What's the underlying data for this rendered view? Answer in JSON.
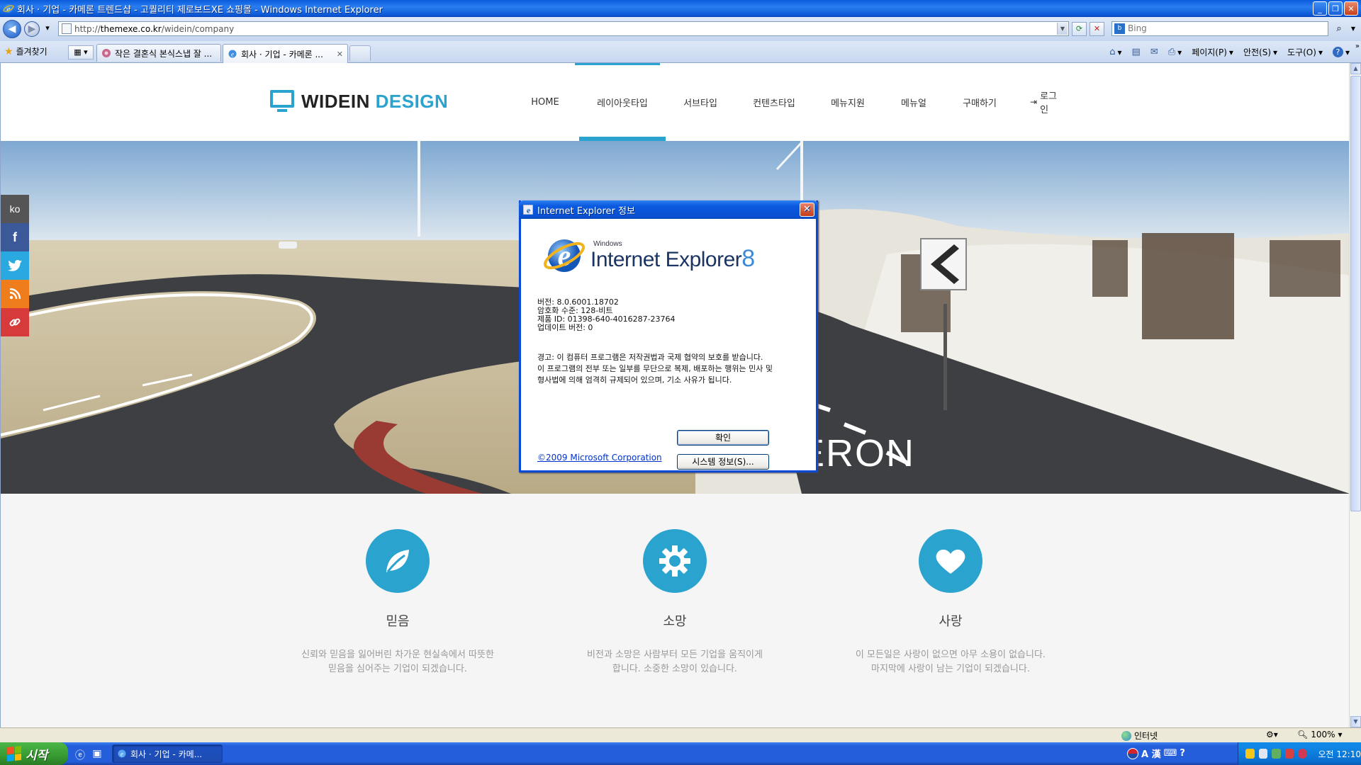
{
  "window": {
    "title": "회사 · 기업 - 카메론 트렌드샵 - 고퀄리티 제로보드XE 쇼핑몰 - Windows Internet Explorer",
    "minimize": "_",
    "maximize": "❐",
    "close": "✕"
  },
  "address": {
    "prefix": "http://",
    "domain": "themexe.co.kr",
    "path": "/widein/company",
    "search_placeholder": "Bing",
    "bing_logo": "b"
  },
  "favorites": {
    "label": "즐겨찾기"
  },
  "tabs": [
    {
      "label": "작은 결혼식 본식스냅 잘 ..."
    },
    {
      "label": "회사 · 기업 - 카메론 ...",
      "close": "✕"
    }
  ],
  "commandbar": {
    "page": "페이지(P)",
    "safety": "안전(S)",
    "tools": "도구(O)",
    "help": "?"
  },
  "site": {
    "logo_word1": "WIDEIN",
    "logo_word2": "DESIGN",
    "menu": [
      {
        "label": "HOME"
      },
      {
        "label": "레이아웃타입"
      },
      {
        "label": "서브타입"
      },
      {
        "label": "컨텐츠타입"
      },
      {
        "label": "메뉴지원"
      },
      {
        "label": "메뉴얼"
      },
      {
        "label": "구매하기"
      },
      {
        "label": "로그인"
      }
    ],
    "hero_text": "CAMERON",
    "social": {
      "lang": "ko",
      "facebook": "f"
    },
    "features": [
      {
        "title": "믿음",
        "desc1": "신뢰와 믿음을 잃어버린 차가운 현실속에서 따뜻한",
        "desc2": "믿음을 심어주는 기업이 되겠습니다.",
        "icon": "leaf-icon"
      },
      {
        "title": "소망",
        "desc1": "비전과 소망은 사람부터 모든 기업을 움직이게",
        "desc2": "합니다. 소중한 소망이 있습니다.",
        "icon": "gear-icon"
      },
      {
        "title": "사랑",
        "desc1": "이 모든일은 사랑이 없으면 아무 소용이 없습니다.",
        "desc2": "마지막에 사랑이 남는 기업이 되겠습니다.",
        "icon": "heart-icon"
      }
    ]
  },
  "dialog": {
    "title": "Internet Explorer 정보",
    "logo_windows": "Windows",
    "logo_name": "Internet Explorer",
    "logo_version": "8",
    "version": "버전: 8.0.6001.18702",
    "cipher": "암호화 수준: 128-비트",
    "product_id": "제품 ID: 01398-640-4016287-23764",
    "update": "업데이트 버전: 0",
    "warn1": "경고: 이 컴퓨터 프로그램은 저작권법과 국제 협약의 보호를 받습니다.",
    "warn2": "이 프로그램의 전부 또는 일부를 무단으로 복제, 배포하는 행위는 민사 및",
    "warn3": "형사법에 의해 엄격히 규제되어 있으며, 기소 사유가 됩니다.",
    "ok_label": "확인",
    "sysinfo_label": "시스템 정보(S)...",
    "copyright": "©2009 Microsoft Corporation"
  },
  "statusbar": {
    "zone": "인터넷",
    "zoom": "100%"
  },
  "taskbar": {
    "start": "시작",
    "task": "회사 · 기업 - 카메...",
    "clock": "오전 12:10"
  },
  "colors": {
    "accent": "#2aa3cf",
    "xp_blue": "#0a5bdc"
  }
}
